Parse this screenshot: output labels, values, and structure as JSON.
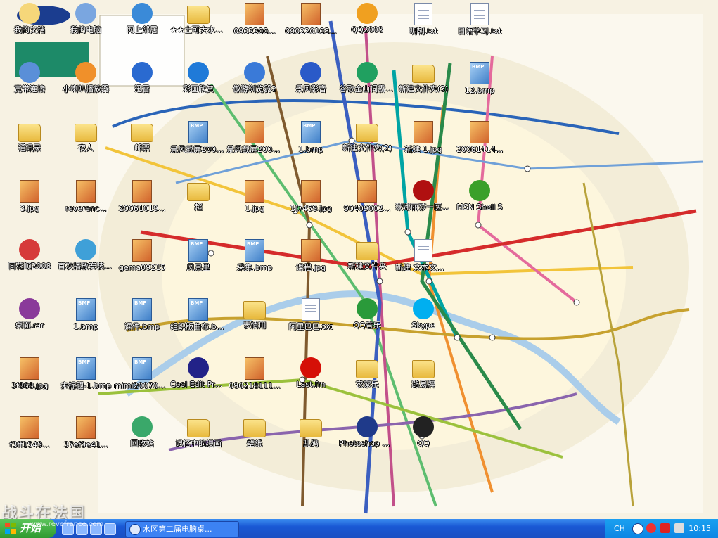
{
  "desktop": {
    "icons": [
      {
        "label": "我的文档",
        "icon": "my-documents-icon"
      },
      {
        "label": "宽带连接",
        "icon": "broadband-icon"
      },
      {
        "label": "通讯录",
        "icon": "folder-icon"
      },
      {
        "label": "3.jpg",
        "icon": "jpg-icon"
      },
      {
        "label": "同花顺2008",
        "icon": "cards-app-icon"
      },
      {
        "label": "桌面.rar",
        "icon": "rar-icon"
      },
      {
        "label": "3f868.jpg",
        "icon": "jpg-icon"
      },
      {
        "label": "f3ff1549...",
        "icon": "jpg-icon"
      },
      {
        "label": "我的电脑",
        "icon": "my-computer-icon"
      },
      {
        "label": "小喇叭播放器",
        "icon": "speaker-app-icon"
      },
      {
        "label": "夜人",
        "icon": "folder-icon"
      },
      {
        "label": "reverenc...",
        "icon": "jpg-icon"
      },
      {
        "label": "首次播放安装程序",
        "icon": "setup-icon"
      },
      {
        "label": "1.bmp",
        "icon": "bmp-icon"
      },
      {
        "label": "未标题-1.bmp",
        "icon": "bmp-icon"
      },
      {
        "label": "37ef9e41...",
        "icon": "jpg-icon"
      },
      {
        "label": "网上邻居",
        "icon": "network-icon"
      },
      {
        "label": "迅雷",
        "icon": "thunder-app-icon"
      },
      {
        "label": "邮票",
        "icon": "folder-icon"
      },
      {
        "label": "20061019...",
        "icon": "jpg-icon"
      },
      {
        "label": "gema09215",
        "icon": "jpg-icon"
      },
      {
        "label": "课件.bmp",
        "icon": "bmp-icon"
      },
      {
        "label": "mimi200705...",
        "icon": "bmp-icon"
      },
      {
        "label": "回收站",
        "icon": "recycle-bin-icon"
      },
      {
        "label": "★★土可大水大★★★土可大水彩画欣赏",
        "icon": "folder-icon"
      },
      {
        "label": "彩画欣赏",
        "icon": "ie-icon"
      },
      {
        "label": "景风截屏20090301...",
        "icon": "bmp-icon"
      },
      {
        "label": "超",
        "icon": "folder-icon"
      },
      {
        "label": "风景里",
        "icon": "bmp-icon"
      },
      {
        "label": "组织版曲布.bmp",
        "icon": "bmp-icon"
      },
      {
        "label": "Cool Edit Pro 2.1",
        "icon": "cool-edit-icon"
      },
      {
        "label": "记忆中的漫画",
        "icon": "folder-icon"
      },
      {
        "label": "0902200...",
        "icon": "jpg-icon"
      },
      {
        "label": "傲游浏览器2",
        "icon": "maxthon-icon"
      },
      {
        "label": "景风截屏20090301...",
        "icon": "jpg-icon"
      },
      {
        "label": "1.jpg",
        "icon": "jpg-icon"
      },
      {
        "label": "采集.bmp",
        "icon": "bmp-icon"
      },
      {
        "label": "表情用",
        "icon": "folder-icon"
      },
      {
        "label": "090218111...",
        "icon": "jpg-icon"
      },
      {
        "label": "壁纸",
        "icon": "folder-icon"
      },
      {
        "label": "090220103...",
        "icon": "jpg-icon"
      },
      {
        "label": "景风影音",
        "icon": "media-icon"
      },
      {
        "label": "1.bmp",
        "icon": "bmp-icon"
      },
      {
        "label": "1f7459.jpg",
        "icon": "jpg-icon"
      },
      {
        "label": "课程.jpg",
        "icon": "jpg-icon"
      },
      {
        "label": "阿里巴巴.txt",
        "icon": "file-icon"
      },
      {
        "label": "Last.fm",
        "icon": "lastfm-icon"
      },
      {
        "label": "乱码",
        "icon": "folder-icon"
      },
      {
        "label": "QQ2008",
        "icon": "qq-icon"
      },
      {
        "label": "谷歌金山词霸辅助软件",
        "icon": "dict-icon"
      },
      {
        "label": "新建文件夹(2)",
        "icon": "folder-icon"
      },
      {
        "label": "90409002...",
        "icon": "jpg-icon"
      },
      {
        "label": "新建文件夹",
        "icon": "folder-icon"
      },
      {
        "label": "QQ音乐",
        "icon": "qq-music-icon"
      },
      {
        "label": "农家乐",
        "icon": "folder-icon"
      },
      {
        "label": "Photoshop 绿色优化版",
        "icon": "photoshop-icon"
      },
      {
        "label": "明朝.txt",
        "icon": "file-icon"
      },
      {
        "label": "新建文件夹(3)",
        "icon": "folder-icon"
      },
      {
        "label": "新建 1.jpg",
        "icon": "jpg-icon"
      },
      {
        "label": "蒙娜丽莎一医生加强版",
        "icon": "game-icon"
      },
      {
        "label": "新建 文本文档.txt",
        "icon": "file-icon"
      },
      {
        "label": "Skype",
        "icon": "skype-icon"
      },
      {
        "label": "路易牌",
        "icon": "folder-icon"
      },
      {
        "label": "QQ",
        "icon": "qq-penguin-icon"
      },
      {
        "label": "日语学习.txt",
        "icon": "file-icon"
      },
      {
        "label": "12.bmp",
        "icon": "bmp-icon"
      },
      {
        "label": "20081414...",
        "icon": "jpg-icon"
      },
      {
        "label": "MSN Shell 5",
        "icon": "msn-icon"
      }
    ]
  },
  "watermark": {
    "brand": "战斗在法国",
    "url": "www.revefrance.com"
  },
  "taskbar": {
    "start_label": "开始",
    "task_item": "水区第二届电脑桌...",
    "language": "CH",
    "clock": "10:15"
  },
  "colors": {
    "taskbar": "#1f5ed8",
    "start": "#3fa93f",
    "map_bg": "#f7f2e3"
  }
}
